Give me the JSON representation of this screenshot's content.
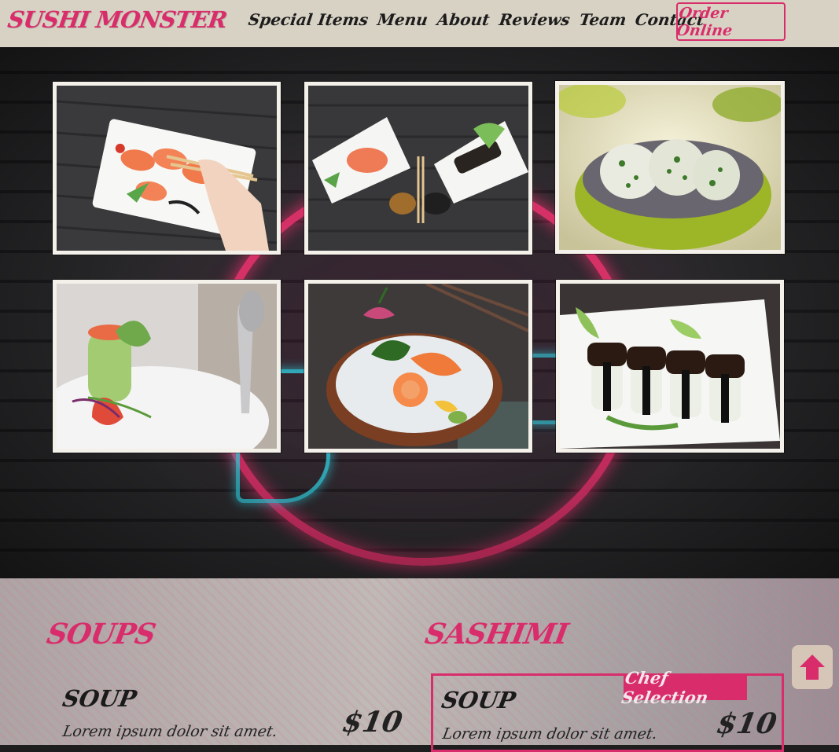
{
  "navbar": {
    "brand": "SUSHI MONSTER",
    "links": [
      "Special Items",
      "Menu",
      "About",
      "Reviews",
      "Team",
      "Contact"
    ],
    "order_label": "Order Online"
  },
  "gallery": {
    "photos": [
      "salmon-nigiri-plate-photo",
      "sashimi-platter-photo",
      "sushi-rolls-bowl-photo",
      "cucumber-roll-photo",
      "sashimi-garnish-photo",
      "eel-nigiri-photo"
    ]
  },
  "menu": {
    "soups": {
      "heading": "SOUPS",
      "items": [
        {
          "name": "SOUP",
          "description": "Lorem ipsum dolor sit amet.",
          "price": "$10"
        }
      ]
    },
    "sashimi": {
      "heading": "SASHIMI",
      "badge": "Chef Selection",
      "items": [
        {
          "name": "SOUP",
          "description": "Lorem ipsum dolor sit amet.",
          "price": "$10"
        }
      ]
    }
  },
  "back_to_top_icon": "arrow-up-icon",
  "colors": {
    "accent": "#d92d6b",
    "navbar": "#d8d2c4"
  }
}
